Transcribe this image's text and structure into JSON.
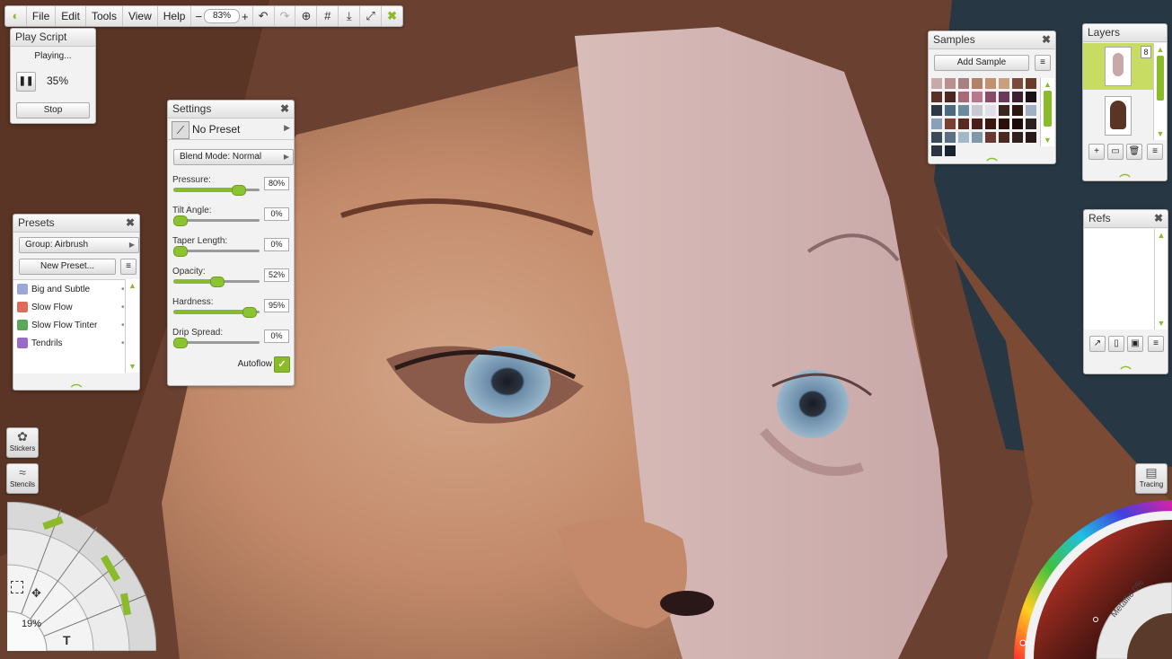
{
  "menubar": {
    "items": [
      "File",
      "Edit",
      "Tools",
      "View",
      "Help"
    ],
    "zoom_minus": "−",
    "zoom_value": "83%",
    "zoom_plus": "+"
  },
  "play_script": {
    "title": "Play Script",
    "status": "Playing...",
    "progress": "35%",
    "stop_label": "Stop"
  },
  "settings": {
    "title": "Settings",
    "preset": "No Preset",
    "blend_mode": "Blend Mode: Normal",
    "sliders": [
      {
        "label": "Pressure:",
        "value": "80%",
        "level": 0.75
      },
      {
        "label": "Tilt Angle:",
        "value": "0%",
        "level": 0.0
      },
      {
        "label": "Taper Length:",
        "value": "0%",
        "level": 0.0
      },
      {
        "label": "Opacity:",
        "value": "52%",
        "level": 0.5
      },
      {
        "label": "Hardness:",
        "value": "95%",
        "level": 0.88
      },
      {
        "label": "Drip Spread:",
        "value": "0%",
        "level": 0.0
      }
    ],
    "autoflow_label": "Autoflow",
    "autoflow_check": "✓"
  },
  "presets": {
    "title": "Presets",
    "group": "Group: Airbrush",
    "new_preset": "New Preset...",
    "items": [
      {
        "label": "Big and Subtle",
        "color": "#9aa8d8"
      },
      {
        "label": "Slow Flow",
        "color": "#e06a5a"
      },
      {
        "label": "Slow Flow Tinter",
        "color": "#5aa85a"
      },
      {
        "label": "Tendrils",
        "color": "#9a6ac8"
      }
    ]
  },
  "samples": {
    "title": "Samples",
    "add_label": "Add Sample",
    "swatches": [
      "#c8a8a8",
      "#b89090",
      "#a88080",
      "#b08068",
      "#c09070",
      "#c8a080",
      "#7a4a3a",
      "#6a3a2a",
      "#5a3028",
      "#4a2820",
      "#a86878",
      "#b87890",
      "#8a4a68",
      "#6a3a58",
      "#3a2030",
      "#1a1018",
      "#2a3848",
      "#4a6a80",
      "#6a8aa0",
      "#c8c8d0",
      "#e0e0e8",
      "#3a2820",
      "#2a1810",
      "#a0b0c0",
      "#8aa0b8",
      "#7a4030",
      "#5a2a20",
      "#4a2018",
      "#3a1810",
      "#2a1008",
      "#1a0a08",
      "#2a2020",
      "#3a4a58",
      "#5a7080",
      "#a0b8c8",
      "#8098a8",
      "#6a3a30",
      "#4a2a20",
      "#302020",
      "#281818",
      "#2a3440",
      "#1a2430"
    ]
  },
  "layers": {
    "title": "Layers",
    "lock_icon_label": "8"
  },
  "refs": {
    "title": "Refs"
  },
  "tools": {
    "stickers_label": "Stickers",
    "stencils_label": "Stencils",
    "tracing_label": "Tracing",
    "size_value": "19%",
    "text_tool_glyph": "T"
  },
  "color_picker": {
    "metallic_label": "Metallic 0%"
  }
}
